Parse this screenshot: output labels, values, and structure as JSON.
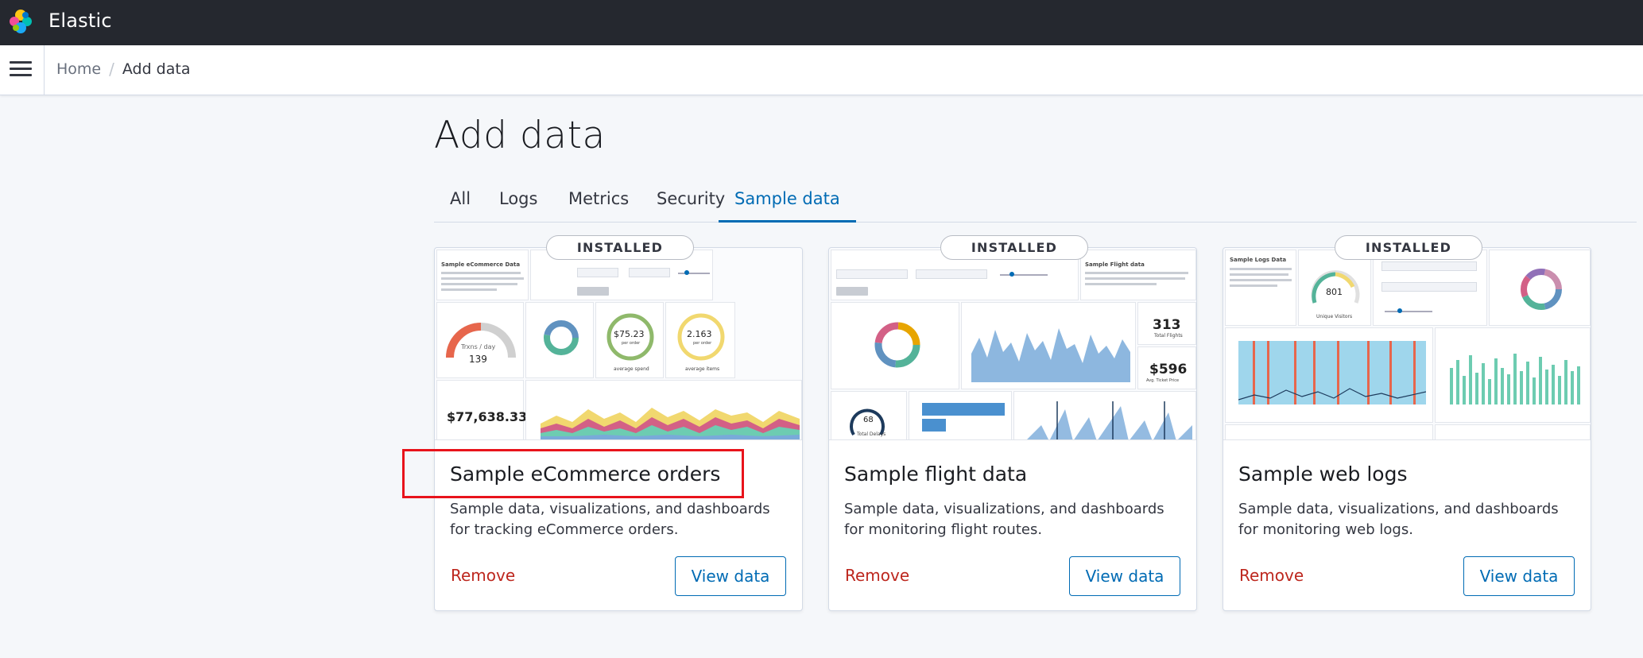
{
  "header": {
    "brand": "Elastic"
  },
  "breadcrumbs": {
    "home": "Home",
    "separator": "/",
    "current": "Add data"
  },
  "page": {
    "title": "Add data"
  },
  "tabs": [
    {
      "label": "All",
      "active": false
    },
    {
      "label": "Logs",
      "active": false
    },
    {
      "label": "Metrics",
      "active": false
    },
    {
      "label": "Security",
      "active": false
    },
    {
      "label": "Sample data",
      "active": true
    }
  ],
  "cards": [
    {
      "badge": "INSTALLED",
      "title": "Sample eCommerce orders",
      "description": "Sample data, visualizations, and dashboards for tracking eCommerce orders.",
      "remove_label": "Remove",
      "view_label": "View data",
      "thumb": {
        "heading": "Sample eCommerce Data",
        "gauge_label": "Trxns / day",
        "gauge_value": "139",
        "donut_value": "$75.23",
        "donut_sub": "per order",
        "donut_caption": "average spend",
        "donut2_value": "2.163",
        "donut2_sub": "per order",
        "donut2_caption": "average items",
        "revenue": "$77,638.33"
      }
    },
    {
      "badge": "INSTALLED",
      "title": "Sample flight data",
      "description": "Sample data, visualizations, and dashboards for monitoring flight routes.",
      "remove_label": "Remove",
      "view_label": "View data",
      "thumb": {
        "heading": "Sample Flight data",
        "total_flights": "313",
        "total_flights_label": "Total Flights",
        "avg_price": "$596",
        "avg_price_label": "Avg. Ticket Price",
        "delays_value": "68",
        "delays_label": "Total Delays"
      }
    },
    {
      "badge": "INSTALLED",
      "title": "Sample web logs",
      "description": "Sample data, visualizations, and dashboards for monitoring web logs.",
      "remove_label": "Remove",
      "view_label": "View data",
      "thumb": {
        "heading": "Sample Logs Data",
        "gauge_value": "801",
        "gauge_label": "Unique Visitors"
      }
    }
  ],
  "colors": {
    "header_bg": "#25282f",
    "accent": "#006bb4",
    "danger": "#bd271e",
    "highlight": "#e8131b"
  }
}
